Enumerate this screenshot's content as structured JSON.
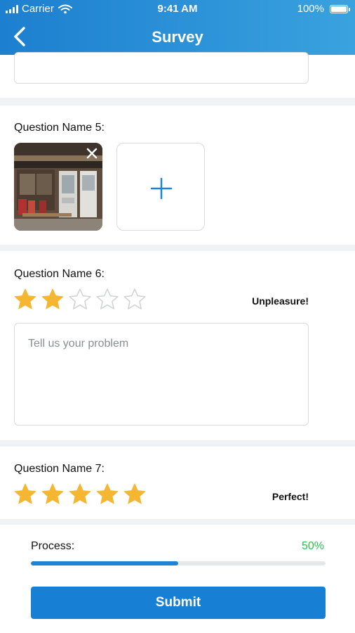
{
  "status_bar": {
    "carrier": "Carrier",
    "time": "9:41 AM",
    "battery": "100%"
  },
  "header": {
    "title": "Survey"
  },
  "question5": {
    "label": "Question Name 5:"
  },
  "question6": {
    "label": "Question Name 6:",
    "rating": 2,
    "max_rating": 5,
    "rating_text": "Unpleasure!",
    "textarea_placeholder": "Tell us your problem"
  },
  "question7": {
    "label": "Question Name 7:",
    "rating": 5,
    "max_rating": 5,
    "rating_text": "Perfect!"
  },
  "footer": {
    "process_label": "Process:",
    "process_value": "50%",
    "progress_fraction": 0.5,
    "submit_label": "Submit"
  },
  "colors": {
    "header_start": "#1c7fd0",
    "header_end": "#3aa2df",
    "accent": "#1780d4",
    "star_filled": "#f5b731",
    "star_empty_stroke": "#cfd1d4",
    "progress_value": "#2dbd52"
  }
}
